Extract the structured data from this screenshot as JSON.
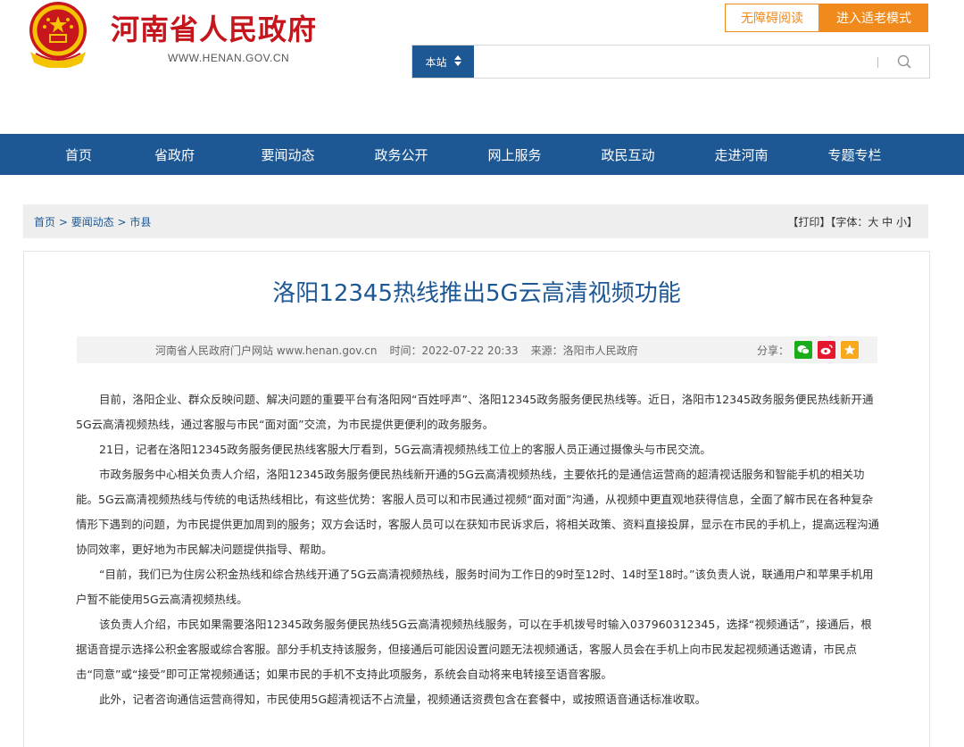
{
  "header": {
    "site_title": "河南省人民政府",
    "site_url": "WWW.HENAN.GOV.CN",
    "accessibility_label": "无障碍阅读",
    "elder_mode_label": "进入适老模式"
  },
  "search": {
    "scope_label": "本站",
    "placeholder": ""
  },
  "nav": {
    "items": [
      "首页",
      "省政府",
      "要闻动态",
      "政务公开",
      "网上服务",
      "政民互动",
      "走进河南",
      "专题专栏"
    ]
  },
  "breadcrumb": {
    "items": [
      "首页",
      "要闻动态",
      "市县"
    ],
    "separator": " > ",
    "tools": "【打印】【字体：大 中 小】"
  },
  "article": {
    "title": "洛阳12345热线推出5G云高清视频功能",
    "meta_source": "河南省人民政府门户网站 www.henan.gov.cn",
    "meta_time": "时间：2022-07-22 20:33",
    "meta_origin": "来源：洛阳市人民政府",
    "share_label": "分享：",
    "paragraphs": [
      "目前，洛阳企业、群众反映问题、解决问题的重要平台有洛阳网“百姓呼声”、洛阳12345政务服务便民热线等。近日，洛阳市12345政务服务便民热线新开通5G云高清视频热线，通过客服与市民“面对面”交流，为市民提供更便利的政务服务。",
      "21日，记者在洛阳12345政务服务便民热线客服大厅看到，5G云高清视频热线工位上的客服人员正通过摄像头与市民交流。",
      "市政务服务中心相关负责人介绍，洛阳12345政务服务便民热线新开通的5G云高清视频热线，主要依托的是通信运营商的超清视话服务和智能手机的相关功能。5G云高清视频热线与传统的电话热线相比，有这些优势：客服人员可以和市民通过视频“面对面”沟通，从视频中更直观地获得信息，全面了解市民在各种复杂情形下遇到的问题，为市民提供更加周到的服务；双方会话时，客服人员可以在获知市民诉求后，将相关政策、资料直接投屏，显示在市民的手机上，提高远程沟通协同效率，更好地为市民解决问题提供指导、帮助。",
      "“目前，我们已为住房公积金热线和综合热线开通了5G云高清视频热线，服务时间为工作日的9时至12时、14时至18时。”该负责人说，联通用户和苹果手机用户暂不能使用5G云高清视频热线。",
      "该负责人介绍，市民如果需要洛阳12345政务服务便民热线5G云高清视频热线服务，可以在手机拨号时输入037960312345，选择“视频通话”，接通后，根据语音提示选择公积金客服或综合客服。部分手机支持该服务，但接通后可能因设置问题无法视频通话，客服人员会在手机上向市民发起视频通话邀请，市民点击“同意”或“接受”即可正常视频通话；如果市民的手机不支持此项服务，系统会自动将来电转接至语音客服。",
      "此外，记者咨询通信运营商得知，市民使用5G超清视话不占流量，视频通话资费包含在套餐中，或按照语音通话标准收取。"
    ]
  },
  "icons": {
    "emblem": "national-emblem-icon",
    "search": "search-icon",
    "share": [
      "wechat-icon",
      "weibo-icon",
      "favorite-icon"
    ]
  },
  "colors": {
    "brand_red": "#c4161c",
    "brand_blue": "#1d5894",
    "accent_orange": "#f08a1c"
  }
}
